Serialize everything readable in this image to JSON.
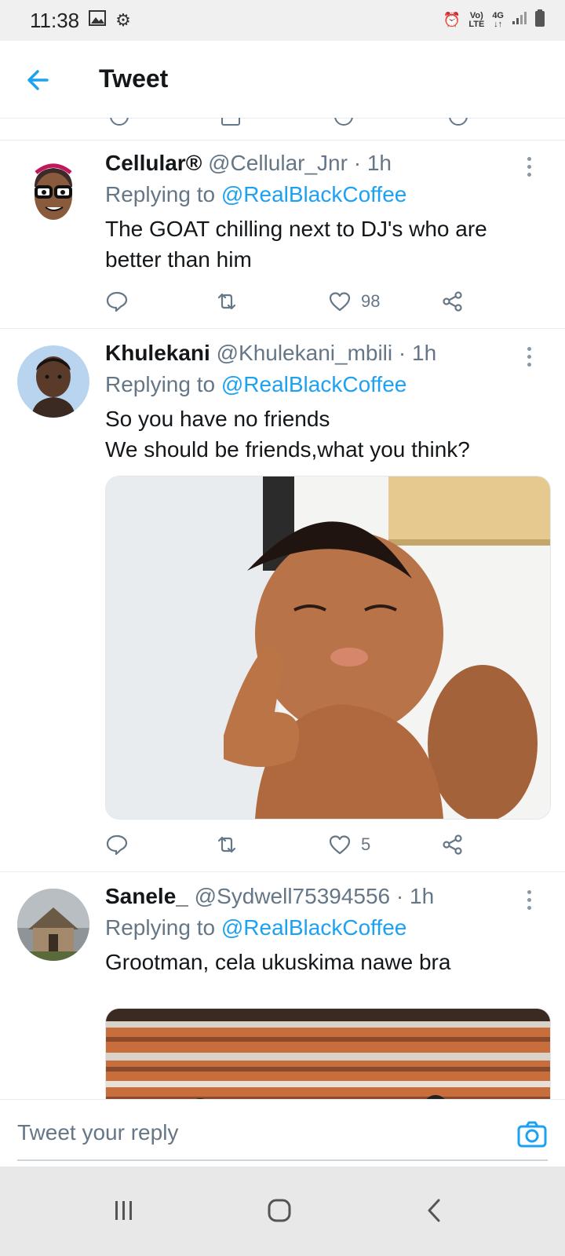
{
  "status_bar": {
    "time": "11:38",
    "network_top": "Vo)",
    "network_bottom": "LTE",
    "signal_top": "4G",
    "signal_bottom": "↓↑"
  },
  "app_bar": {
    "title": "Tweet",
    "back_icon": "arrow-left-icon"
  },
  "tweets": [
    {
      "name": "Cellular®",
      "handle": "@Cellular_Jnr",
      "time": "· 1h",
      "replying_prefix": "Replying to",
      "replying_to": "@RealBlackCoffee",
      "text_lines": [
        "The GOAT chilling next to DJ's who are",
        "better than him"
      ],
      "likes": "98"
    },
    {
      "name": "Khulekani",
      "handle": "@Khulekani_mbili",
      "time": "· 1h",
      "replying_prefix": "Replying to",
      "replying_to": "@RealBlackCoffee",
      "text_lines": [
        "So you have no friends",
        "We should be friends,what you think?"
      ],
      "likes": "5"
    },
    {
      "name": "Sanele_",
      "handle": "@Sydwell75394556",
      "time": "· 1h",
      "replying_prefix": "Replying to",
      "replying_to": "@RealBlackCoffee",
      "text_lines": [
        "Grootman, cela ukuskima nawe bra"
      ],
      "likes": ""
    }
  ],
  "reply_bar": {
    "placeholder": "Tweet your reply",
    "camera_icon": "camera-icon"
  },
  "nav_bar": {
    "icons": [
      "recent-apps-icon",
      "home-icon",
      "back-icon"
    ]
  },
  "colors": {
    "accent": "#1da1f2",
    "secondary_text": "#657786",
    "divider": "#e6ecf0"
  }
}
